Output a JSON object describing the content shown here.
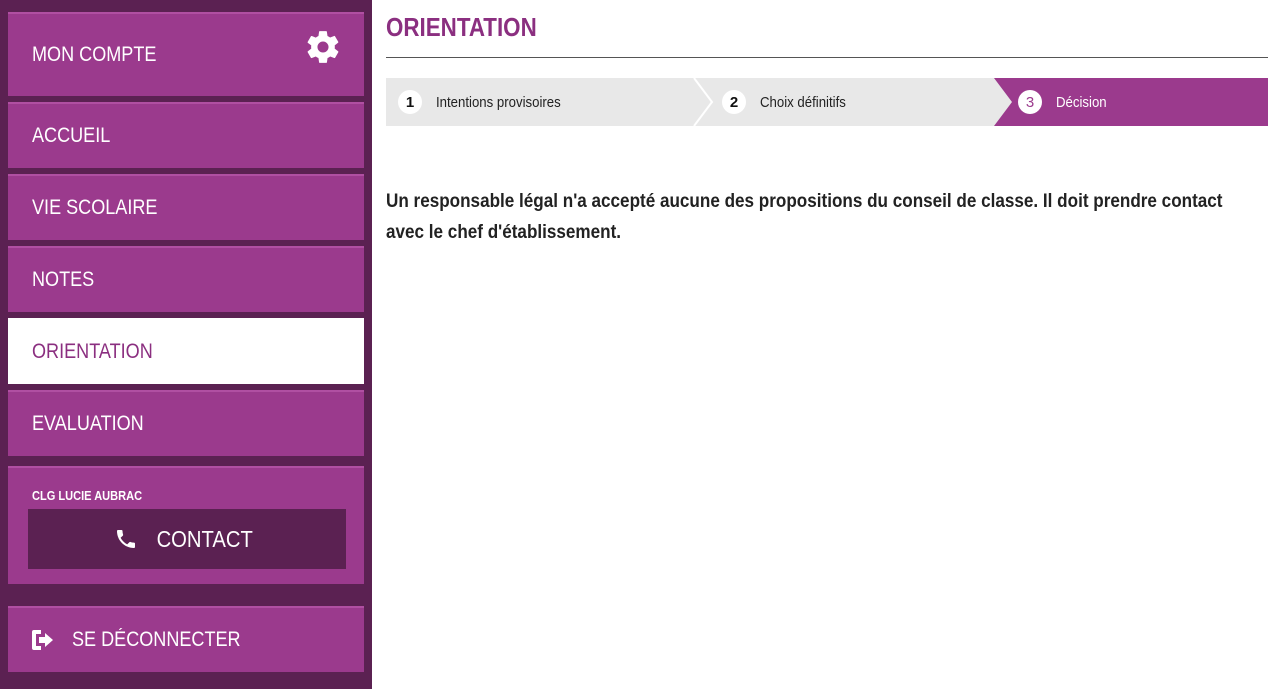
{
  "sidebar": {
    "account": {
      "label": "MON COMPTE",
      "icon": "gear-icon"
    },
    "items": [
      {
        "label": "ACCUEIL",
        "active": false
      },
      {
        "label": "VIE SCOLAIRE",
        "active": false
      },
      {
        "label": "NOTES",
        "active": false
      },
      {
        "label": "ORIENTATION",
        "active": true
      },
      {
        "label": "EVALUATION",
        "active": false
      }
    ],
    "school": {
      "name": "CLG LUCIE AUBRAC",
      "contact_label": "CONTACT",
      "contact_icon": "phone-icon"
    },
    "logout": {
      "label": "SE DÉCONNECTER",
      "icon": "logout-icon"
    }
  },
  "main": {
    "title": "ORIENTATION",
    "steps": [
      {
        "number": "1",
        "label": "Intentions provisoires",
        "active": false
      },
      {
        "number": "2",
        "label": "Choix définitifs",
        "active": false
      },
      {
        "number": "3",
        "label": "Décision",
        "active": true
      }
    ],
    "message": "Un responsable légal n'a accepté aucune des propositions du conseil de classe. Il doit prendre contact avec le chef d'établissement."
  },
  "colors": {
    "accent": "#9b3a8d",
    "sidebar_dark": "#5b2152",
    "stepper_bg": "#e8e8e8",
    "title_color": "#8b2f80"
  }
}
